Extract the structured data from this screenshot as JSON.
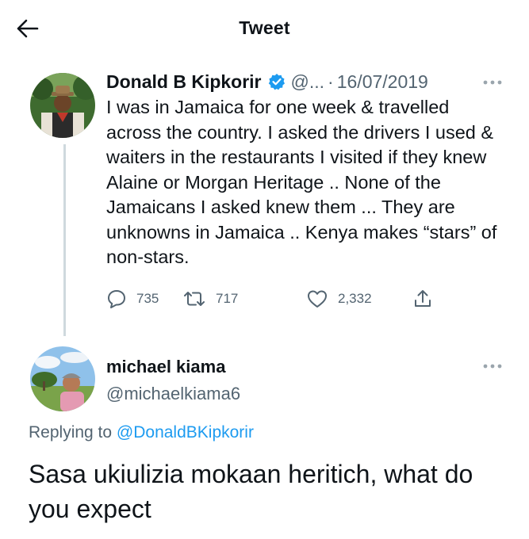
{
  "header": {
    "title": "Tweet",
    "back_icon": "arrow-left-icon"
  },
  "tweet": {
    "display_name": "Donald B Kipkorir",
    "handle": "@...",
    "separator": "·",
    "date": "16/07/2019",
    "verified_icon": "verified-badge-icon",
    "text": "I was in Jamaica for one week & travelled across the country. I asked the drivers I used & waiters in the restaurants I visited if they knew Alaine or Morgan Heritage .. None of the Jamaicans I asked knew them ... They are unknowns in Jamaica .. Kenya makes “stars” of non-stars.",
    "counts": {
      "replies": "735",
      "retweets": "717",
      "likes": "2,332"
    }
  },
  "reply": {
    "display_name": "michael kiama",
    "handle": "@michaelkiama6",
    "replying_label": "Replying to",
    "replying_to": "@DonaldBKipkorir",
    "text": "Sasa ukiulizia mokaan heritich, what do you expect"
  },
  "colors": {
    "link": "#1d9bf0",
    "muted": "#536471",
    "text": "#0f1419",
    "thread_line": "#cfd9de"
  }
}
